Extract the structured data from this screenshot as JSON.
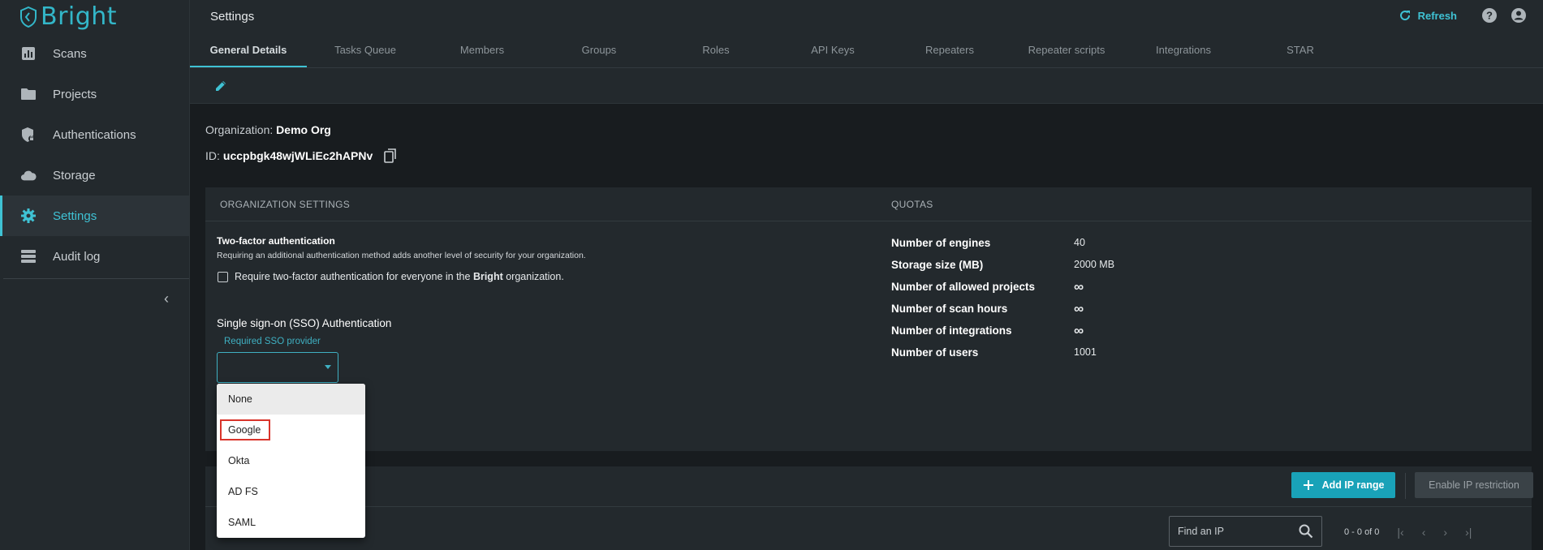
{
  "app": {
    "logo_text": "Bright"
  },
  "sidebar": {
    "items": [
      {
        "label": "Scans",
        "icon": "bar-chart-icon"
      },
      {
        "label": "Projects",
        "icon": "folder-icon"
      },
      {
        "label": "Authentications",
        "icon": "shield-lock-icon"
      },
      {
        "label": "Storage",
        "icon": "cloud-icon"
      },
      {
        "label": "Settings",
        "icon": "gear-icon",
        "active": true
      },
      {
        "label": "Audit log",
        "icon": "list-icon"
      }
    ],
    "collapse_glyph": "‹"
  },
  "header": {
    "title": "Settings",
    "refresh_label": "Refresh",
    "help_icon": "help-icon",
    "account_icon": "account-circle-icon"
  },
  "tabs": [
    {
      "label": "General Details",
      "active": true
    },
    {
      "label": "Tasks Queue"
    },
    {
      "label": "Members"
    },
    {
      "label": "Groups"
    },
    {
      "label": "Roles"
    },
    {
      "label": "API Keys"
    },
    {
      "label": "Repeaters"
    },
    {
      "label": "Repeater scripts"
    },
    {
      "label": "Integrations"
    },
    {
      "label": "STAR"
    }
  ],
  "organization": {
    "name_label": "Organization:",
    "name": "Demo Org",
    "id_label": "ID:",
    "id": "uccpbgk48wjWLiEc2hAPNv"
  },
  "org_settings": {
    "header": "ORGANIZATION SETTINGS",
    "tfa_title": "Two-factor authentication",
    "tfa_desc": "Requiring an additional authentication method adds another level of security for your organization.",
    "tfa_check_prefix": "Require two-factor authentication for everyone in the",
    "tfa_check_brand": "Bright",
    "tfa_check_suffix": "organization.",
    "sso_title": "Single sign-on (SSO) Authentication",
    "sso_label": "Required SSO provider",
    "sso_value": "",
    "sso_options": [
      "None",
      "Google",
      "Okta",
      "AD FS",
      "SAML"
    ]
  },
  "quotas": {
    "header": "QUOTAS",
    "rows": [
      {
        "label": "Number of engines",
        "value": "40"
      },
      {
        "label": "Storage size (MB)",
        "value": "2000 MB"
      },
      {
        "label": "Number of allowed projects",
        "value": "∞"
      },
      {
        "label": "Number of scan hours",
        "value": "∞"
      },
      {
        "label": "Number of integrations",
        "value": "∞"
      },
      {
        "label": "Number of users",
        "value": "1001"
      }
    ]
  },
  "ip_restrictions": {
    "add_label": "Add IP range",
    "enable_label": "Enable IP restriction",
    "search_placeholder": "Find an IP",
    "pager_text": "0 - 0 of 0"
  },
  "colors": {
    "accent": "#3fc2d4",
    "primary_button": "#19a2b8",
    "highlight_box": "#d9342b"
  }
}
